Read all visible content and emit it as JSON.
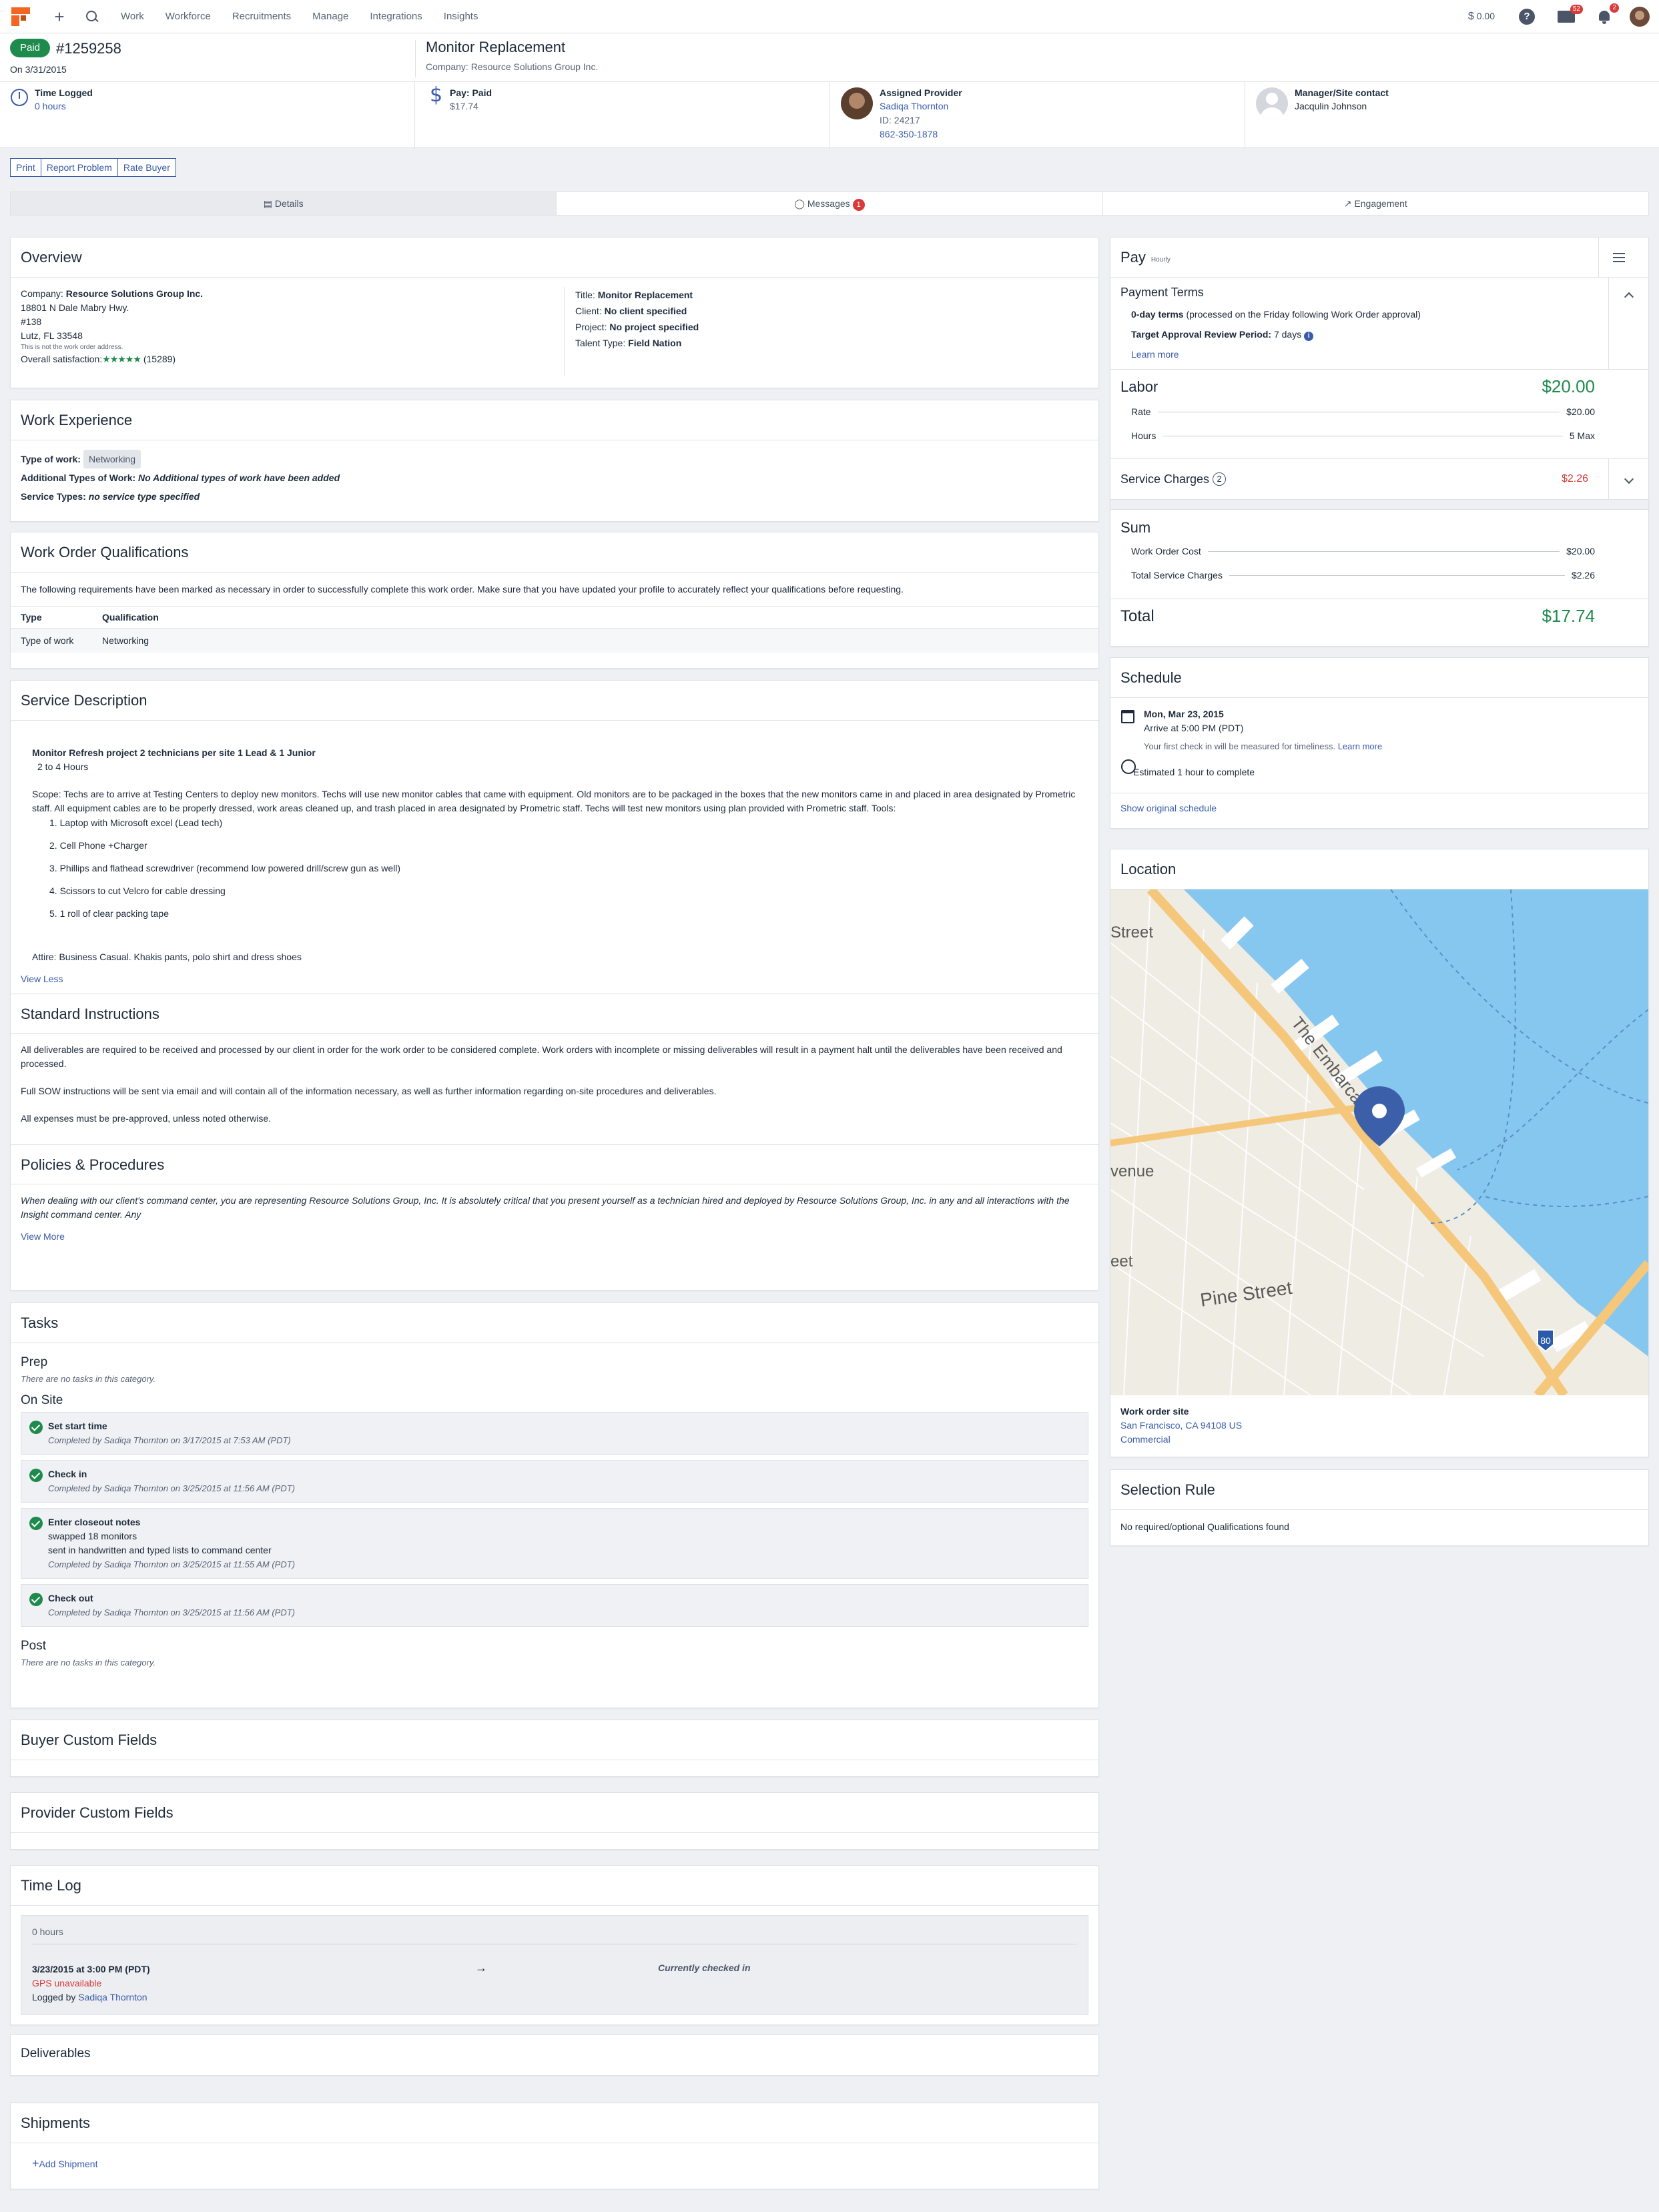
{
  "nav": {
    "menu": [
      "Work",
      "Workforce",
      "Recruitments",
      "Manage",
      "Integrations",
      "Insights"
    ],
    "balance_symbol": "$",
    "balance": "0.00",
    "help": "?",
    "mail_count": "52",
    "notif_count": "2"
  },
  "header": {
    "status": "Paid",
    "wo_number": "#1259258",
    "date_line": "On 3/31/2015",
    "title": "Monitor Replacement",
    "company_line": "Company: Resource Solutions Group Inc."
  },
  "strip": {
    "time_label": "Time Logged",
    "time_value": "0 hours",
    "pay_label": "Pay: Paid",
    "pay_value": "$17.74",
    "provider_label": "Assigned Provider",
    "provider_name": "Sadiqa Thornton",
    "provider_id": "ID: 24217",
    "provider_phone": "862-350-1878",
    "manager_label": "Manager/Site contact",
    "manager_name": "Jacqulin Johnson"
  },
  "actions": [
    "Print",
    "Report Problem",
    "Rate Buyer"
  ],
  "tabs": {
    "details": "Details",
    "messages": "Messages",
    "messages_count": "1",
    "engagement": "Engagement"
  },
  "overview": {
    "title": "Overview",
    "company_label": "Company:",
    "company": "Resource Solutions Group Inc.",
    "addr1": "18801 N Dale Mabry Hwy.",
    "addr2": "#138",
    "addr3": "Lutz, FL 33548",
    "addr_note": "This is not the work order address.",
    "sat_label": "Overall satisfaction:",
    "stars": "★★★★★",
    "sat_count": "(15289)",
    "title_label": "Title:",
    "title_val": "Monitor Replacement",
    "client_label": "Client:",
    "client_val": "No client specified",
    "project_label": "Project:",
    "project_val": "No project specified",
    "talent_label": "Talent Type:",
    "talent_val": "Field Nation"
  },
  "experience": {
    "title": "Work Experience",
    "type_label": "Type of work:",
    "type_val": "Networking",
    "add_label": "Additional Types of Work:",
    "add_val": "No Additional types of work have been added",
    "svc_label": "Service Types:",
    "svc_val": "no service type specified"
  },
  "quals": {
    "title": "Work Order Qualifications",
    "intro": "The following requirements have been marked as necessary in order to successfully complete this work order. Make sure that you have updated your profile to accurately reflect your qualifications before requesting.",
    "col1": "Type",
    "col2": "Qualification",
    "row_type": "Type of work",
    "row_qual": "Networking"
  },
  "service": {
    "title": "Service Description",
    "heading": "Monitor Refresh project 2 technicians per site 1 Lead & 1 Junior",
    "hours": "2 to 4 Hours",
    "scope": "Scope:  Techs are to arrive at Testing Centers to deploy new monitors.  Techs will use new monitor cables that came with equipment.  Old monitors are to be packaged in the boxes that the new monitors came in and placed in area designated by Prometric staff.  All equipment cables are to be properly dressed, work areas cleaned up, and trash placed in area designated by Prometric staff.  Techs will test new monitors using plan provided with Prometric staff.   Tools:",
    "tools": [
      "1. Laptop with Microsoft excel (Lead tech)",
      "2. Cell Phone +Charger",
      "3. Phillips and flathead screwdriver (recommend low powered drill/screw gun as well)",
      "4. Scissors to cut Velcro for cable dressing",
      "5. 1 roll of clear packing tape"
    ],
    "attire": "Attire: Business Casual.  Khakis pants, polo shirt and dress shoes",
    "view_less": "View Less"
  },
  "standard": {
    "title": "Standard Instructions",
    "p1": "All deliverables are required to be received and processed by our client in order for the work order to be considered complete. Work orders with incomplete or missing deliverables will result in a payment halt until the deliverables have been received and processed.",
    "p2": "Full SOW instructions will be sent via email and will contain all of the information necessary, as well as further information regarding on-site procedures and deliverables.",
    "p3": "All expenses must be pre-approved, unless noted otherwise."
  },
  "policies": {
    "title": "Policies & Procedures",
    "text": "When dealing with our client's command center, you are representing Resource Solutions Group, Inc. It is absolutely critical that you present yourself as a technician hired and deployed by Resource Solutions Group, Inc. in any and all interactions with the Insight command center. Any",
    "view_more": "View More"
  },
  "tasks": {
    "title": "Tasks",
    "prep": "Prep",
    "none": "There are no tasks in this category.",
    "onsite": "On Site",
    "items": [
      {
        "name": "Set start time",
        "note": "",
        "completed": "Completed by Sadiqa Thornton on 3/17/2015 at 7:53 AM (PDT)"
      },
      {
        "name": "Check in",
        "note": "",
        "completed": "Completed by Sadiqa Thornton on 3/25/2015 at 11:56 AM (PDT)"
      },
      {
        "name": "Enter closeout notes",
        "note": "swapped 18 monitors",
        "note2": "sent in handwritten and typed lists to command center",
        "completed": "Completed by Sadiqa Thornton on 3/25/2015 at 11:55 AM (PDT)"
      },
      {
        "name": "Check out",
        "note": "",
        "completed": "Completed by Sadiqa Thornton on 3/25/2015 at 11:56 AM (PDT)"
      }
    ],
    "post": "Post"
  },
  "buyer_fields": {
    "title": "Buyer Custom Fields"
  },
  "provider_fields": {
    "title": "Provider Custom Fields"
  },
  "timelog": {
    "title": "Time Log",
    "hours": "0 hours",
    "checkin": "3/23/2015 at 3:00 PM (PDT)",
    "gps": "GPS unavailable",
    "logged_by": "Logged by",
    "logger": "Sadiqa Thornton",
    "status": "Currently checked in"
  },
  "deliverables": {
    "title": "Deliverables"
  },
  "shipments": {
    "title": "Shipments",
    "add": "Add Shipment"
  },
  "pay": {
    "title": "Pay",
    "hourly": "Hourly",
    "terms_title": "Payment Terms",
    "terms_bold": "0-day terms",
    "terms_rest": "(processed on the Friday following Work Order approval)",
    "review_label": "Target Approval Review Period:",
    "review_val": "7 days",
    "learn_more": "Learn more",
    "labor_label": "Labor",
    "labor_val": "$20.00",
    "rate_label": "Rate",
    "rate_val": "$20.00",
    "hours_label": "Hours",
    "hours_val": "5 Max",
    "svc_label": "Service Charges",
    "svc_count": "2",
    "svc_val": "$2.26",
    "sum_label": "Sum",
    "woc_label": "Work Order Cost",
    "woc_val": "$20.00",
    "tsc_label": "Total Service Charges",
    "tsc_val": "$2.26",
    "total_label": "Total",
    "total_val": "$17.74"
  },
  "schedule": {
    "title": "Schedule",
    "date": "Mon, Mar 23, 2015",
    "arrive": "Arrive at 5:00 PM (PDT)",
    "note": "Your first check in will be measured for timeliness.",
    "learn": "Learn more",
    "estimate": "Estimated 1 hour to complete",
    "show_original": "Show original schedule"
  },
  "location": {
    "title": "Location",
    "map_labels": [
      "Street",
      "The Embarcadero",
      "venue",
      "eet",
      "Pine Street",
      "80"
    ],
    "site_label": "Work order site",
    "site_addr": "San Francisco, CA 94108 US",
    "site_type": "Commercial"
  },
  "selection": {
    "title": "Selection Rule",
    "text": "No required/optional Qualifications found"
  },
  "colors": {
    "accent": "#3a5ca8",
    "paid": "#1e8a4c",
    "alert": "#d93a3a",
    "water": "#86c7f0",
    "land": "#efece4",
    "road": "#f5c77a"
  }
}
